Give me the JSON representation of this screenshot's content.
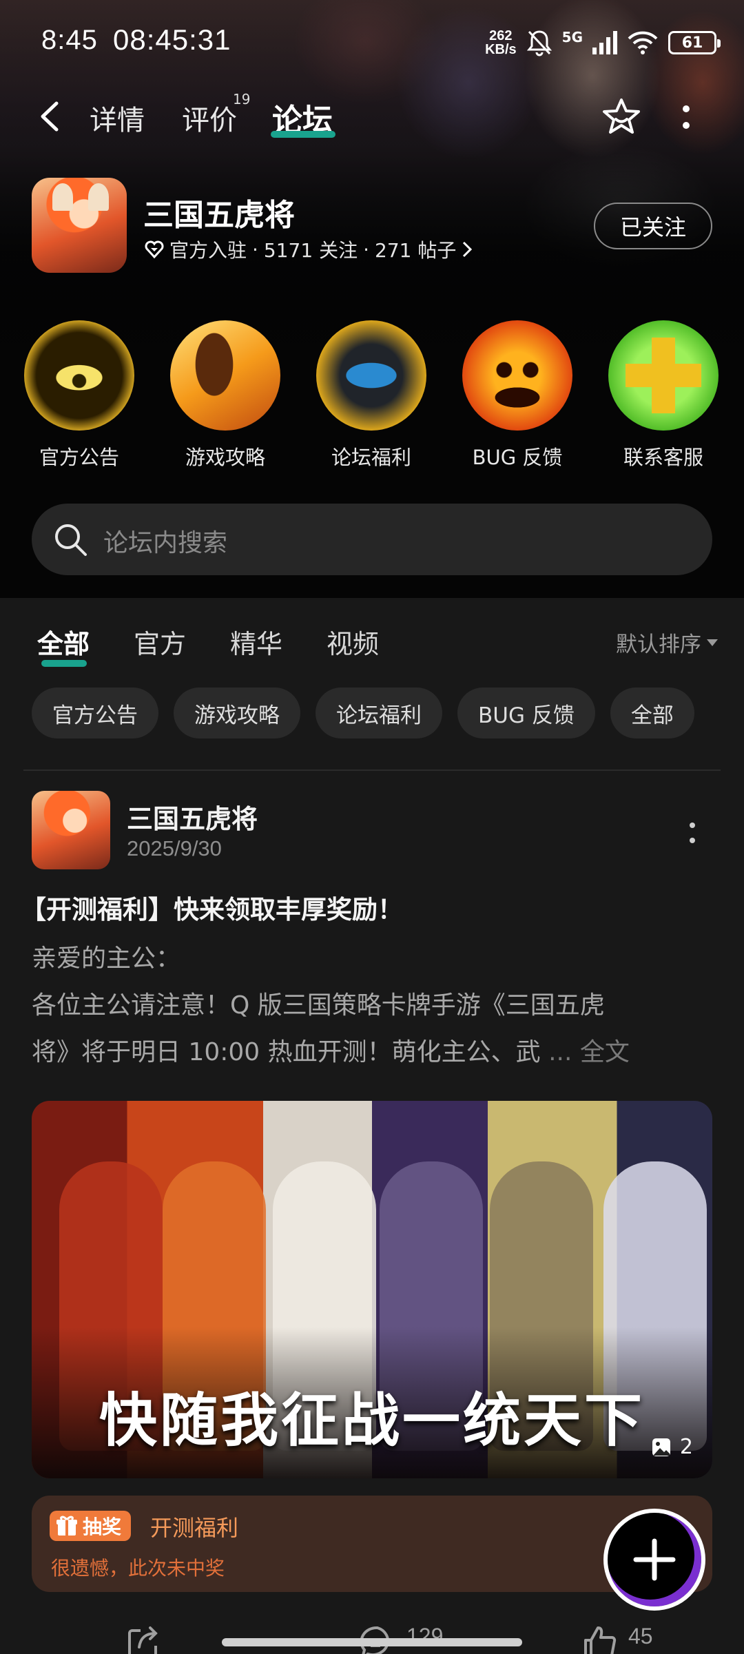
{
  "status_bar": {
    "time": "8:45",
    "clock": "08:45:31",
    "net_speed_value": "262",
    "net_speed_unit": "KB/s",
    "network": "5G",
    "battery": "61"
  },
  "nav": {
    "tabs": [
      {
        "label": "详情"
      },
      {
        "label": "评价",
        "badge": "19"
      },
      {
        "label": "论坛",
        "active": true
      }
    ]
  },
  "game": {
    "title": "三国五虎将",
    "meta": {
      "official": "官方入驻",
      "followers": "5171 关注",
      "posts": "271 帖子",
      "sep": "·"
    },
    "follow_button": "已关注"
  },
  "categories": [
    {
      "label": "官方公告",
      "icon": "cat-eye-icon"
    },
    {
      "label": "游戏攻略",
      "icon": "guide-icon"
    },
    {
      "label": "论坛福利",
      "icon": "welfare-icon"
    },
    {
      "label": "BUG 反馈",
      "icon": "pumpkin-icon"
    },
    {
      "label": "联系客服",
      "icon": "plus-cross-icon"
    }
  ],
  "search": {
    "placeholder": "论坛内搜索"
  },
  "feed_tabs": [
    {
      "label": "全部",
      "active": true
    },
    {
      "label": "官方"
    },
    {
      "label": "精华"
    },
    {
      "label": "视频"
    }
  ],
  "sort": {
    "label": "默认排序"
  },
  "chips": [
    "官方公告",
    "游戏攻略",
    "论坛福利",
    "BUG 反馈",
    "全部"
  ],
  "post": {
    "author": "三国五虎将",
    "date": "2025/9/30",
    "title": "【开测福利】快来领取丰厚奖励！",
    "body_lines": [
      "亲爱的主公：",
      " 各位主公请注意！Q 版三国策略卡牌手游《三国五虎",
      "将》将于明日 10:00 热血开测！萌化主公、武"
    ],
    "ellipsis": " ... ",
    "full_text": "全文",
    "image_caption": "快随我征战一统天下",
    "image_count": "2",
    "lottery": {
      "badge": "抽奖",
      "title": "开测福利",
      "result": "很遗憾，此次未中奖"
    },
    "actions": {
      "comments": "129",
      "likes": "45"
    }
  },
  "colors": {
    "accent": "#19a38e",
    "background": "#181818",
    "lottery_bg": "#3f2a22",
    "lottery_text": "#f59a5a"
  }
}
